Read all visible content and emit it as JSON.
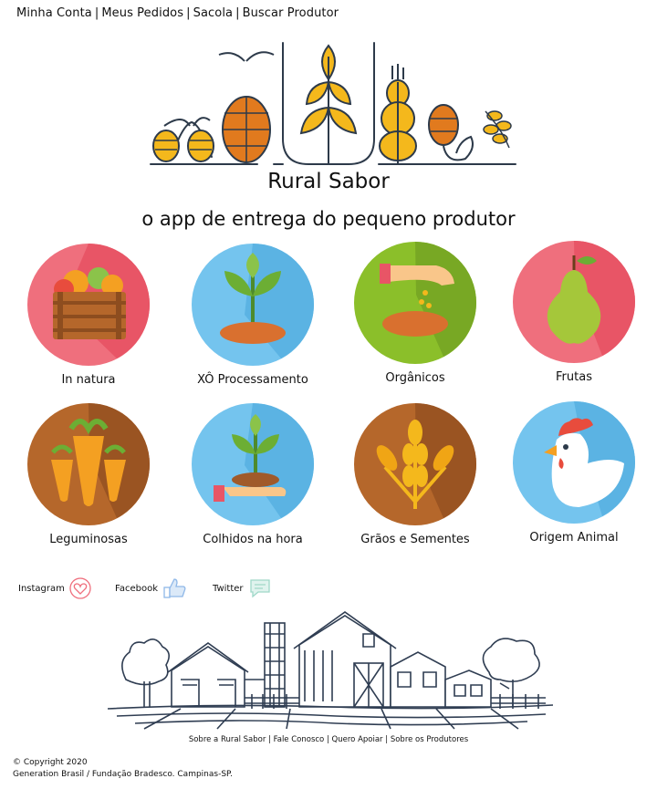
{
  "nav": {
    "items": [
      "Minha Conta",
      "Meus Pedidos",
      "Sacola",
      "Buscar Produtor"
    ],
    "separator": "|"
  },
  "brand": {
    "name": "Rural Sabor",
    "tagline": "o app de entrega do pequeno produtor"
  },
  "categories": [
    {
      "label": "In natura",
      "icon": "vegetable-crate-icon",
      "color": "#ef6f7d"
    },
    {
      "label": "XÔ Processamento",
      "icon": "sprout-icon",
      "color": "#74c4ee"
    },
    {
      "label": "Orgânicos",
      "icon": "hand-seeding-icon",
      "color": "#8bbf2a"
    },
    {
      "label": "Frutas",
      "icon": "pear-icon",
      "color": "#ef6f7d"
    },
    {
      "label": "Leguminosas",
      "icon": "carrots-icon",
      "color": "#b5672b"
    },
    {
      "label": "Colhidos na hora",
      "icon": "hand-sprout-icon",
      "color": "#74c4ee"
    },
    {
      "label": "Grãos e Sementes",
      "icon": "wheat-icon",
      "color": "#b5672b"
    },
    {
      "label": "Origem Animal",
      "icon": "chicken-icon",
      "color": "#74c4ee"
    }
  ],
  "social": [
    {
      "label": "Instagram",
      "icon": "heart-icon"
    },
    {
      "label": "Facebook",
      "icon": "thumbs-up-icon"
    },
    {
      "label": "Twitter",
      "icon": "comment-icon"
    }
  ],
  "footer": {
    "links": [
      "Sobre a Rural Sabor",
      "Fale Conosco",
      "Quero Apoiar",
      "Sobre os Produtores"
    ],
    "separator": "|",
    "copyright": "© Copyright 2020",
    "credit": "Generation Brasil / Fundação Bradesco. Campinas-SP."
  },
  "colors": {
    "wheat": "#f4b81c",
    "hop": "#e17a1e",
    "outline": "#2d3a4a",
    "farm": "#2f3d52"
  }
}
